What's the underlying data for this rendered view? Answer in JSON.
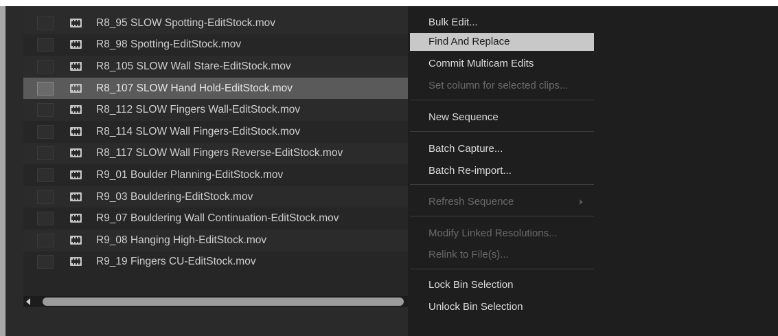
{
  "clips": [
    {
      "name": "R8_95 SLOW Spotting-EditStock.mov",
      "selected": false
    },
    {
      "name": "R8_98 Spotting-EditStock.mov",
      "selected": false
    },
    {
      "name": "R8_105 SLOW Wall Stare-EditStock.mov",
      "selected": false
    },
    {
      "name": "R8_107 SLOW Hand Hold-EditStock.mov",
      "selected": true
    },
    {
      "name": "R8_112 SLOW Fingers Wall-EditStock.mov",
      "selected": false
    },
    {
      "name": "R8_114 SLOW Wall Fingers-EditStock.mov",
      "selected": false
    },
    {
      "name": "R8_117 SLOW Wall Fingers Reverse-EditStock.mov",
      "selected": false
    },
    {
      "name": "R9_01 Boulder Planning-EditStock.mov",
      "selected": false
    },
    {
      "name": "R9_03 Bouldering-EditStock.mov",
      "selected": false
    },
    {
      "name": "R9_07 Bouldering Wall Continuation-EditStock.mov",
      "selected": false
    },
    {
      "name": "R9_08 Hanging High-EditStock.mov",
      "selected": false
    },
    {
      "name": "R9_19 Fingers CU-EditStock.mov",
      "selected": false
    }
  ],
  "menu": {
    "bulk_edit": "Bulk Edit...",
    "find_and_replace": "Find And Replace",
    "commit_multicam_edits": "Commit Multicam Edits",
    "set_column": "Set column for selected clips...",
    "new_sequence": "New Sequence",
    "batch_capture": "Batch Capture...",
    "batch_reimport": "Batch Re-import...",
    "refresh_sequence": "Refresh Sequence",
    "modify_linked_resolutions": "Modify Linked Resolutions...",
    "relink_to_files": "Relink to File(s)...",
    "lock_bin_selection": "Lock Bin Selection",
    "unlock_bin_selection": "Unlock Bin Selection"
  },
  "icons": {
    "clip": "film-clip-icon",
    "scroll_left": "scroll-left-arrow-icon",
    "submenu": "submenu-arrow-icon"
  },
  "colors": {
    "menu_highlight": "#c8c8c8",
    "selected_row": "#5a5a5a",
    "disabled_text": "#6a6a6a"
  }
}
